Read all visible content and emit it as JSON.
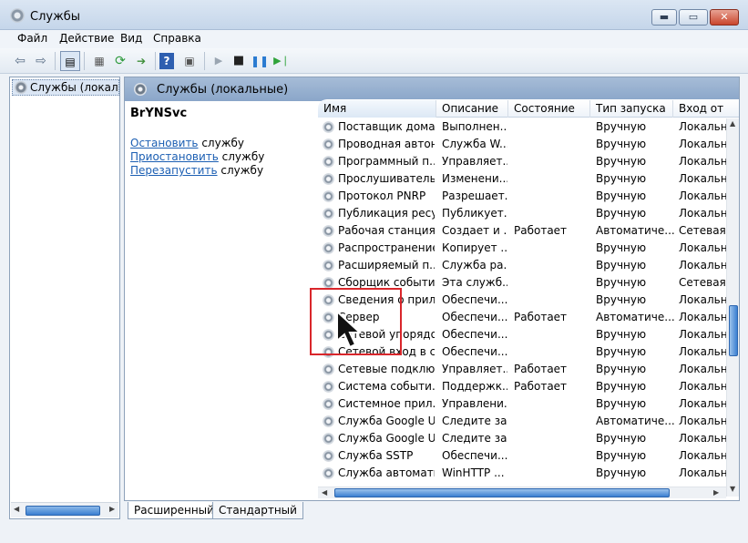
{
  "window": {
    "title": "Службы"
  },
  "title_buttons": {
    "minimize": "▬",
    "maximize": "▭",
    "close": "✕"
  },
  "menu": [
    "Файл",
    "Действие",
    "Вид",
    "Справка"
  ],
  "toolbar": {
    "icons": [
      "back-arrow-icon",
      "forward-arrow-icon",
      "show-console-tree-icon",
      "properties-icon",
      "refresh-icon",
      "export-list-icon",
      "help-icon",
      "show-action-pane-icon",
      "start-service-icon",
      "stop-service-icon",
      "pause-service-icon",
      "resume-service-icon"
    ]
  },
  "tree": {
    "root_label": "Службы (локаль"
  },
  "pane_header": {
    "title": "Службы (локальные)"
  },
  "description": {
    "service_name": "BrYNSvc",
    "actions": [
      {
        "link": "Остановить",
        "suffix": " службу"
      },
      {
        "link": "Приостановить",
        "suffix": " службу"
      },
      {
        "link": "Перезапустить",
        "suffix": " службу"
      }
    ]
  },
  "columns": [
    "Имя",
    "Описание",
    "Состояние",
    "Тип запуска",
    "Вход от"
  ],
  "services": [
    {
      "name": "Поставщик дома...",
      "description": "Выполнен...",
      "state": "",
      "startup": "Вручную",
      "logon": "Локальн"
    },
    {
      "name": "Проводная автон...",
      "description": "Служба W...",
      "state": "",
      "startup": "Вручную",
      "logon": "Локальн"
    },
    {
      "name": "Программный п...",
      "description": "Управляет...",
      "state": "",
      "startup": "Вручную",
      "logon": "Локальн"
    },
    {
      "name": "Прослушиватель...",
      "description": "Изменени...",
      "state": "",
      "startup": "Вручную",
      "logon": "Локальн"
    },
    {
      "name": "Протокол PNRP",
      "description": "Разрешает...",
      "state": "",
      "startup": "Вручную",
      "logon": "Локальн"
    },
    {
      "name": "Публикация ресу...",
      "description": "Публикует...",
      "state": "",
      "startup": "Вручную",
      "logon": "Локальн"
    },
    {
      "name": "Рабочая станция",
      "description": "Создает и ...",
      "state": "Работает",
      "startup": "Автоматиче...",
      "logon": "Сетевая с"
    },
    {
      "name": "Распространение...",
      "description": "Копирует ...",
      "state": "",
      "startup": "Вручную",
      "logon": "Локальн"
    },
    {
      "name": "Расширяемый п...",
      "description": "Служба ра...",
      "state": "",
      "startup": "Вручную",
      "logon": "Локальн"
    },
    {
      "name": "Сборщик событи...",
      "description": "Эта служб...",
      "state": "",
      "startup": "Вручную",
      "logon": "Сетевая с"
    },
    {
      "name": "Сведения о прил...",
      "description": "Обеспечи...",
      "state": "",
      "startup": "Вручную",
      "logon": "Локальн"
    },
    {
      "name": "Сервер",
      "description": "Обеспечи...",
      "state": "Работает",
      "startup": "Автоматиче...",
      "logon": "Локальн"
    },
    {
      "name": "Сетевой упорядоч...",
      "description": "Обеспечи...",
      "state": "",
      "startup": "Вручную",
      "logon": "Локальн"
    },
    {
      "name": "Сетевой вход в си...",
      "description": "Обеспечи...",
      "state": "",
      "startup": "Вручную",
      "logon": "Локальн"
    },
    {
      "name": "Сетевые подклю...",
      "description": "Управляет...",
      "state": "Работает",
      "startup": "Вручную",
      "logon": "Локальн"
    },
    {
      "name": "Система событи...",
      "description": "Поддержк...",
      "state": "Работает",
      "startup": "Вручную",
      "logon": "Локальн"
    },
    {
      "name": "Системное прил...",
      "description": "Управлени...",
      "state": "",
      "startup": "Вручную",
      "logon": "Локальн"
    },
    {
      "name": "Служба Google U...",
      "description": "Следите за...",
      "state": "",
      "startup": "Автоматиче...",
      "logon": "Локальн"
    },
    {
      "name": "Служба Google U...",
      "description": "Следите за...",
      "state": "",
      "startup": "Вручную",
      "logon": "Локальн"
    },
    {
      "name": "Служба SSTP",
      "description": "Обеспечи...",
      "state": "",
      "startup": "Вручную",
      "logon": "Локальн"
    },
    {
      "name": "Служба автомати...",
      "description": "WinHTTP ...",
      "state": "",
      "startup": "Вручную",
      "logon": "Локальн"
    }
  ],
  "tabs": {
    "extended": "Расширенный",
    "standard": "Стандартный"
  },
  "colors": {
    "highlight_box": "#d9262b",
    "link": "#1c5fb3",
    "pane_header": "#9bb4d2"
  }
}
